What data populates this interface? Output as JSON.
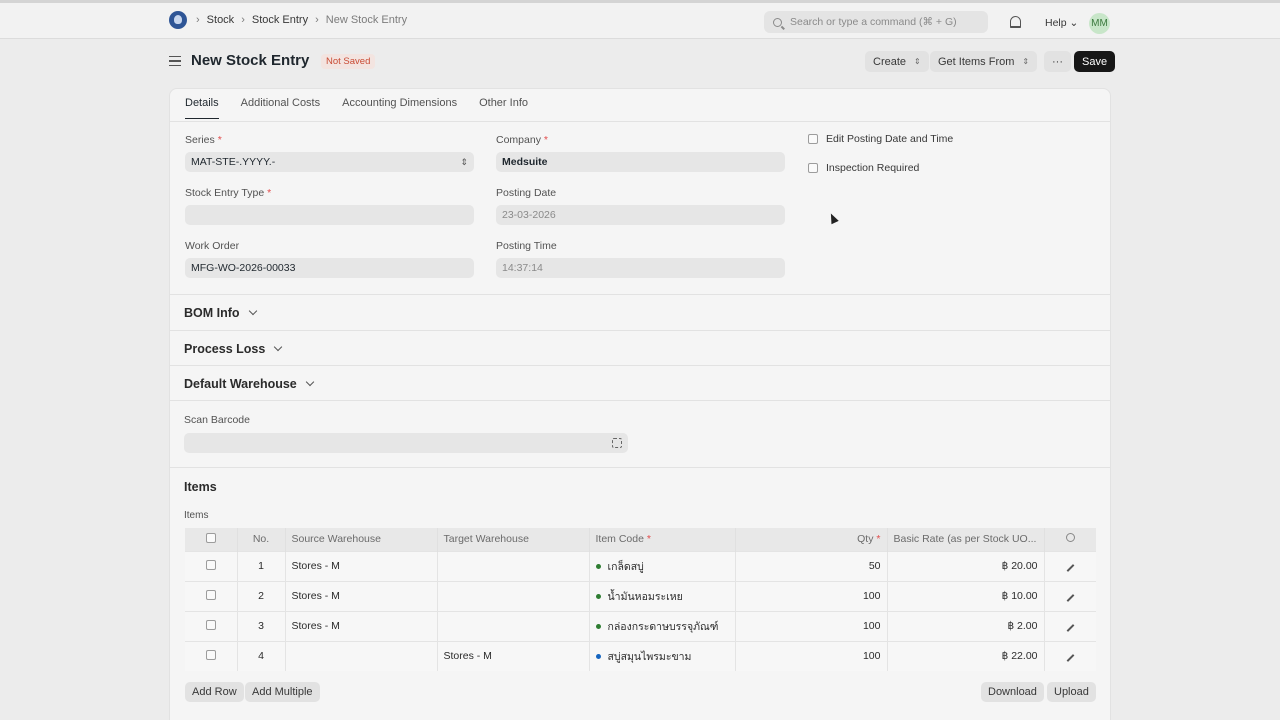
{
  "topbar": {
    "logo": "medsuite-logo-icon",
    "breadcrumbs": [
      "Stock",
      "Stock Entry",
      "New Stock Entry"
    ],
    "search_placeholder": "Search or type a command (⌘ + G)",
    "help_label": "Help",
    "avatar_initials": "MM"
  },
  "page": {
    "title": "New Stock Entry",
    "status_badge": "Not Saved",
    "buttons": {
      "create": "Create",
      "get_items": "Get Items From",
      "more": "···",
      "save": "Save"
    }
  },
  "tabs": [
    "Details",
    "Additional Costs",
    "Accounting Dimensions",
    "Other Info"
  ],
  "form": {
    "series": {
      "label": "Series",
      "value": "MAT-STE-.YYYY.-"
    },
    "company": {
      "label": "Company",
      "value": "Medsuite"
    },
    "stock_entry_type": {
      "label": "Stock Entry Type",
      "value": ""
    },
    "posting_date": {
      "label": "Posting Date",
      "value": "23-03-2026"
    },
    "work_order": {
      "label": "Work Order",
      "value": "MFG-WO-2026-00033"
    },
    "posting_time": {
      "label": "Posting Time",
      "value": "14:37:14"
    },
    "edit_posting": "Edit Posting Date and Time",
    "inspection_required": "Inspection Required"
  },
  "sections": {
    "bom_info": "BOM Info",
    "process_loss": "Process Loss",
    "default_warehouse": "Default Warehouse",
    "scan_barcode": "Scan Barcode",
    "items_title": "Items",
    "items_label": "Items"
  },
  "items_table": {
    "headers": [
      "No.",
      "Source Warehouse",
      "Target Warehouse",
      "Item Code",
      "Qty",
      "Basic Rate (as per Stock UO..."
    ],
    "rows": [
      {
        "no": "1",
        "source": "Stores - M",
        "target": "",
        "item": "เกล็ดสบู่",
        "qty": "50",
        "rate": "฿ 20.00"
      },
      {
        "no": "2",
        "source": "Stores - M",
        "target": "",
        "item": "น้ำมันหอมระเหย",
        "qty": "100",
        "rate": "฿ 10.00"
      },
      {
        "no": "3",
        "source": "Stores - M",
        "target": "",
        "item": "กล่องกระดาษบรรจุภัณฑ์",
        "qty": "100",
        "rate": "฿ 2.00"
      },
      {
        "no": "4",
        "source": "",
        "target": "Stores - M",
        "item": "สบู่สมุนไพรมะขาม",
        "qty": "100",
        "rate": "฿ 22.00"
      }
    ],
    "buttons": {
      "add_row": "Add Row",
      "add_multiple": "Add Multiple",
      "download": "Download",
      "upload": "Upload"
    }
  }
}
